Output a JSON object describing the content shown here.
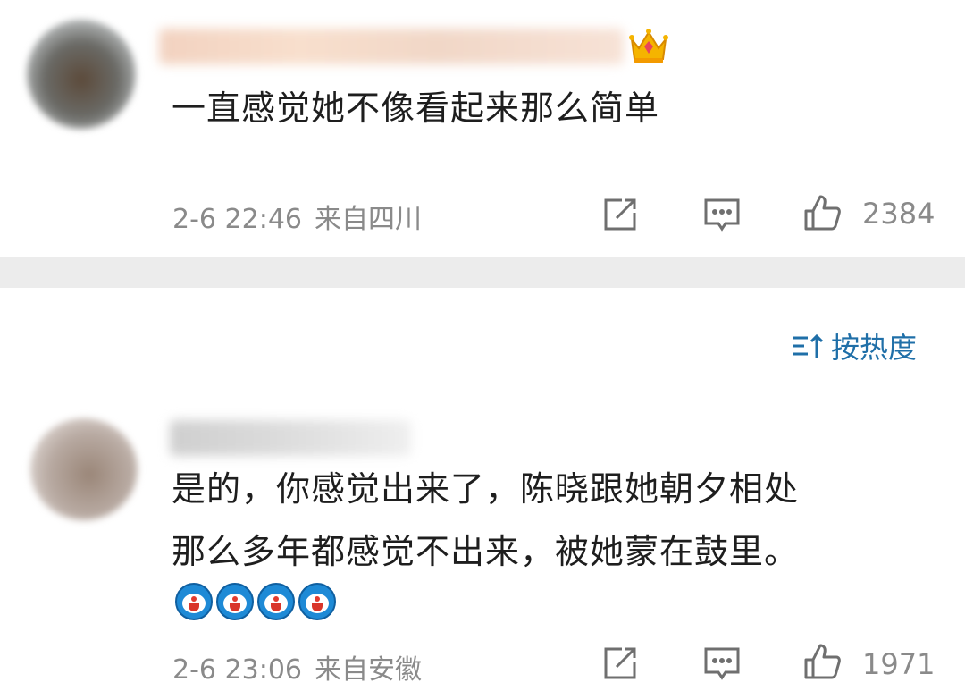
{
  "comments": [
    {
      "text": "一直感觉她不像看起来那么简单",
      "timestamp": "2-6 22:46",
      "location": "来自四川",
      "like_count": "2384",
      "badge_icon": "crown-icon"
    },
    {
      "text_lines": [
        "是的，你感觉出来了，陈晓跟她朝夕相处",
        "那么多年都感觉不出来，被她蒙在鼓里。"
      ],
      "emojis": [
        "doraemon-icon",
        "doraemon-icon",
        "doraemon-icon",
        "doraemon-icon"
      ],
      "timestamp": "2-6 23:06",
      "location": "来自安徽",
      "like_count": "1971"
    }
  ],
  "sort": {
    "label": "按热度"
  },
  "colors": {
    "accent": "#1f6fa8",
    "meta": "#8a8a8a",
    "divider": "#ececec"
  }
}
